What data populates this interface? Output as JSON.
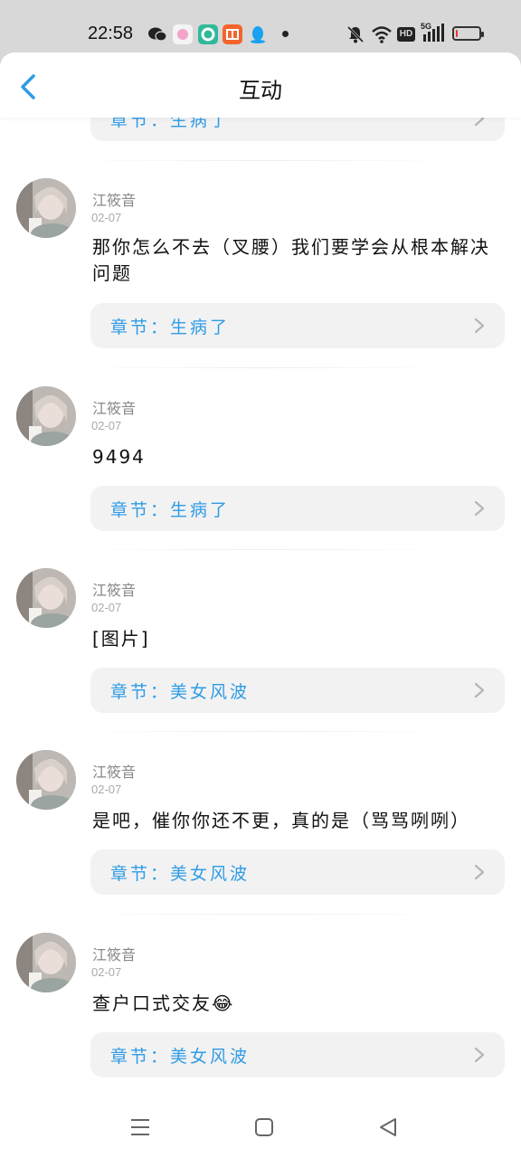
{
  "status_bar": {
    "time": "22:58",
    "icons": [
      "wechat-icon",
      "app-icon-pink",
      "app-icon-green",
      "app-icon-orange",
      "qq-icon"
    ],
    "right_icons": [
      "mute-icon",
      "wifi-icon",
      "hd-icon",
      "signal-5g-icon",
      "battery-icon"
    ],
    "hd_label": "HD",
    "net_label": "5G",
    "battery_level": 0.1
  },
  "header": {
    "title": "互动",
    "accent_color": "#2f9ce4"
  },
  "comments": [
    {
      "chapter_label": "章节：生病了"
    },
    {
      "author": "江筱音",
      "date": "02-07",
      "text": "那你怎么不去（叉腰）我们要学会从根本解决问题",
      "chapter_label": "章节：生病了"
    },
    {
      "author": "江筱音",
      "date": "02-07",
      "text": "9494",
      "chapter_label": "章节：生病了"
    },
    {
      "author": "江筱音",
      "date": "02-07",
      "text": "[图片]",
      "chapter_label": "章节：美女风波"
    },
    {
      "author": "江筱音",
      "date": "02-07",
      "text": "是吧，催你你还不更，真的是（骂骂咧咧）",
      "chapter_label": "章节：美女风波"
    },
    {
      "author": "江筱音",
      "date": "02-07",
      "text": "查户口式交友😂",
      "chapter_label": "章节：美女风波"
    }
  ],
  "nav_bar": {
    "buttons": [
      "menu-icon",
      "home-icon",
      "back-triangle-icon"
    ]
  }
}
